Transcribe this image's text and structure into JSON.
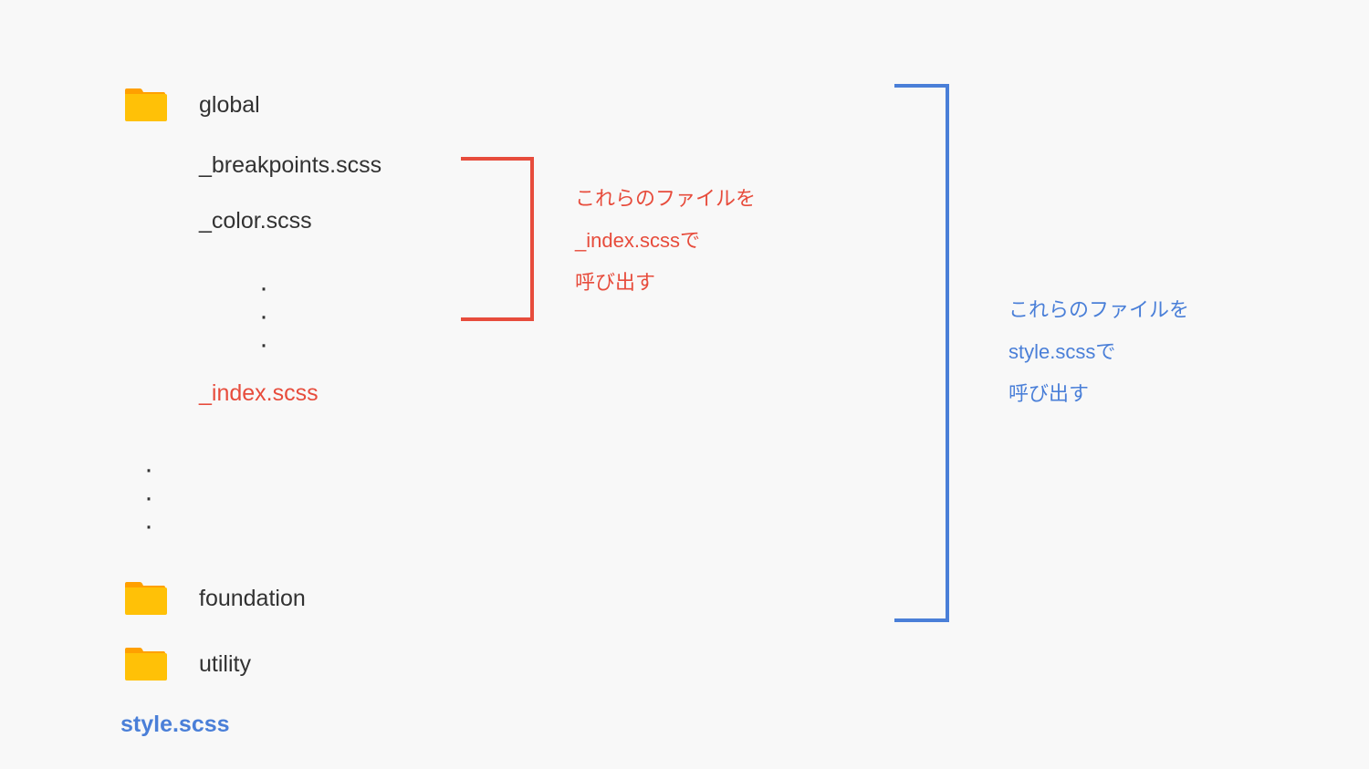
{
  "folders": {
    "global": "global",
    "foundation": "foundation",
    "utility": "utility"
  },
  "files": {
    "breakpoints": "_breakpoints.scss",
    "color": "_color.scss",
    "index": "_index.scss",
    "style": "style.scss"
  },
  "notes": {
    "red": {
      "line1": "これらのファイルを",
      "line2": "_index.scssで",
      "line3": "呼び出す"
    },
    "blue": {
      "line1": "これらのファイルを",
      "line2": "style.scssで",
      "line3": "呼び出す"
    }
  },
  "colors": {
    "folder": "#ffc107",
    "red": "#e74c3c",
    "blue": "#4a7fd8",
    "text": "#323232",
    "bg": "#f8f8f8"
  }
}
